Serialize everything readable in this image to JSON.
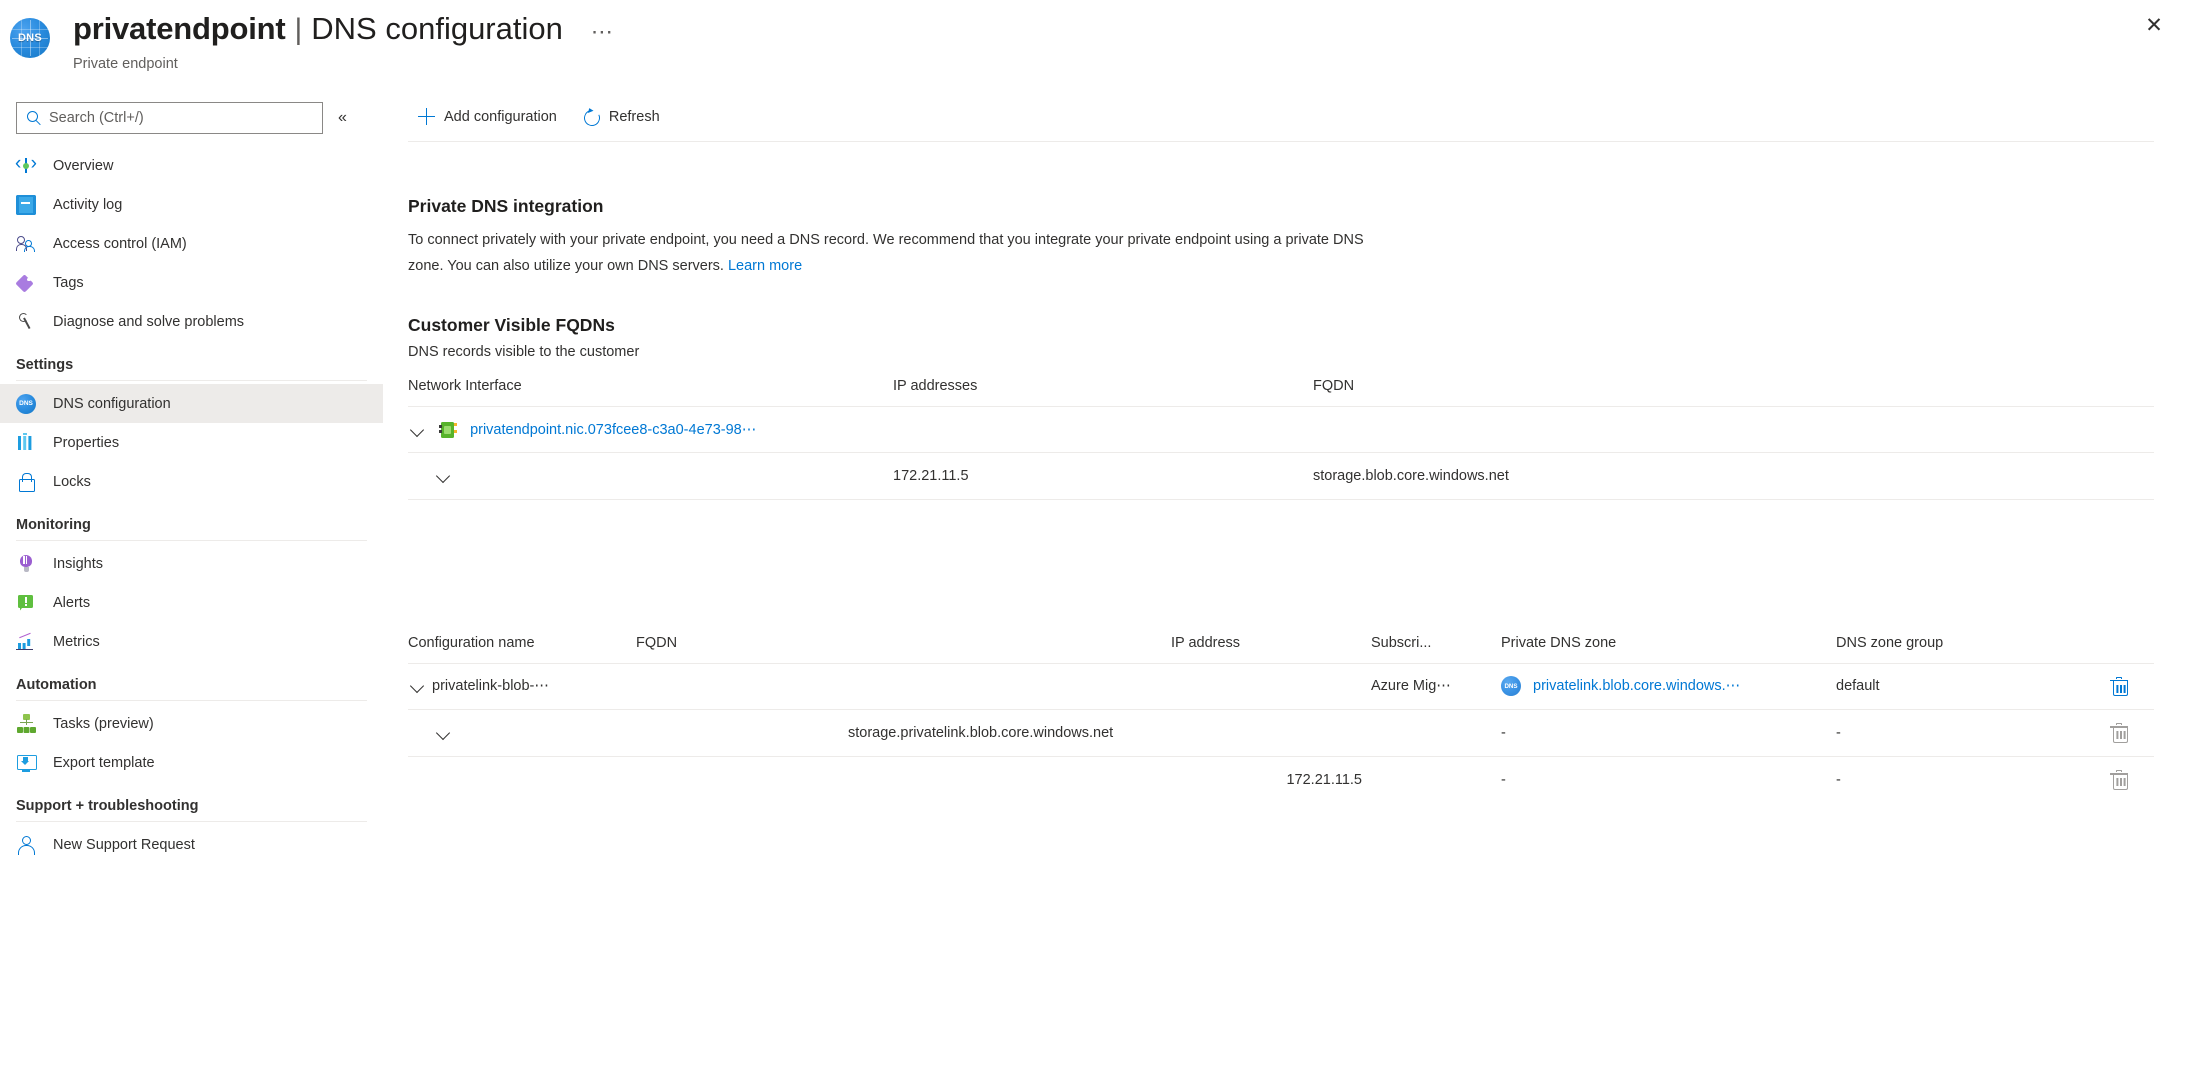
{
  "header": {
    "icon": "dns-globe-icon",
    "resource_name": "privatendpoint",
    "separator": "|",
    "page_name": "DNS configuration",
    "ellipsis": "⋯",
    "subtitle": "Private endpoint",
    "close_label": "✕"
  },
  "search": {
    "placeholder": "Search (Ctrl+/)",
    "value": "",
    "collapse_label": "«"
  },
  "sidebar": {
    "items": [
      {
        "label": "Overview",
        "icon": "overview-icon",
        "selected": false
      },
      {
        "label": "Activity log",
        "icon": "activity-log-icon",
        "selected": false
      },
      {
        "label": "Access control (IAM)",
        "icon": "access-control-icon",
        "selected": false
      },
      {
        "label": "Tags",
        "icon": "tags-icon",
        "selected": false
      },
      {
        "label": "Diagnose and solve problems",
        "icon": "wrench-icon",
        "selected": false
      }
    ],
    "groups": [
      {
        "title": "Settings",
        "items": [
          {
            "label": "DNS configuration",
            "icon": "dns-icon",
            "selected": true
          },
          {
            "label": "Properties",
            "icon": "properties-icon",
            "selected": false
          },
          {
            "label": "Locks",
            "icon": "lock-icon",
            "selected": false
          }
        ]
      },
      {
        "title": "Monitoring",
        "items": [
          {
            "label": "Insights",
            "icon": "lightbulb-icon",
            "selected": false
          },
          {
            "label": "Alerts",
            "icon": "alert-icon",
            "selected": false
          },
          {
            "label": "Metrics",
            "icon": "metrics-icon",
            "selected": false
          }
        ]
      },
      {
        "title": "Automation",
        "items": [
          {
            "label": "Tasks (preview)",
            "icon": "tasks-icon",
            "selected": false
          },
          {
            "label": "Export template",
            "icon": "export-template-icon",
            "selected": false
          }
        ]
      },
      {
        "title": "Support + troubleshooting",
        "items": [
          {
            "label": "New Support Request",
            "icon": "support-person-icon",
            "selected": false
          }
        ]
      }
    ]
  },
  "toolbar": {
    "add_configuration_label": "Add configuration",
    "refresh_label": "Refresh"
  },
  "main": {
    "private_dns_integration": {
      "title": "Private DNS integration",
      "description": "To connect privately with your private endpoint, you need a DNS record. We recommend that you integrate your private endpoint using a private DNS zone. You can also utilize your own DNS servers.",
      "learn_more_label": "Learn more"
    },
    "customer_visible_fqdns": {
      "title": "Customer Visible FQDNs",
      "subtitle": "DNS records visible to the customer",
      "columns": [
        "Network Interface",
        "IP addresses",
        "FQDN"
      ],
      "rows": [
        {
          "expanded": true,
          "indent": 0,
          "has_nic_icon": true,
          "network_interface": "privatendpoint.nic.073fcee8-c3a0-4e73-98⋯",
          "network_interface_is_link": true,
          "ip_addresses": "",
          "fqdn": ""
        },
        {
          "expanded": true,
          "indent": 1,
          "has_nic_icon": false,
          "network_interface": "",
          "network_interface_is_link": false,
          "ip_addresses": "172.21.11.5",
          "fqdn": "storage.blob.core.windows.net"
        },
        {
          "expanded": false,
          "indent": 0,
          "has_nic_icon": false,
          "network_interface": "",
          "network_interface_is_link": false,
          "ip_addresses": "",
          "fqdn": ""
        }
      ]
    },
    "configurations": {
      "columns": [
        "Configuration name",
        "FQDN",
        "IP address",
        "Subscri...",
        "Private DNS zone",
        "DNS zone group"
      ],
      "rows": [
        {
          "expanded": true,
          "indent": 0,
          "configuration_name": "privatelink-blob-⋯",
          "fqdn": "",
          "ip_address": "",
          "subscription": "Azure Mig⋯",
          "private_dns_zone": "privatelink.blob.core.windows.⋯",
          "private_dns_zone_is_link": true,
          "has_dns_zone_icon": true,
          "dns_zone_group": "default",
          "delete_enabled": true
        },
        {
          "expanded": true,
          "indent": 1,
          "configuration_name": "",
          "fqdn": "storage.privatelink.blob.core.windows.net",
          "ip_address": "",
          "subscription": "",
          "private_dns_zone": "-",
          "private_dns_zone_is_link": false,
          "has_dns_zone_icon": false,
          "dns_zone_group": "-",
          "delete_enabled": false
        },
        {
          "expanded": false,
          "indent": 1,
          "configuration_name": "",
          "fqdn": "",
          "ip_address": "172.21.11.5",
          "subscription": "",
          "private_dns_zone": "-",
          "private_dns_zone_is_link": false,
          "has_dns_zone_icon": false,
          "dns_zone_group": "-",
          "delete_enabled": false
        }
      ]
    }
  },
  "colors": {
    "accent": "#0078d4",
    "text": "#323130",
    "muted": "#605e5c",
    "rule": "#edebe9",
    "selected_bg": "#edebe9",
    "disabled_icon": "#a19f9d"
  }
}
